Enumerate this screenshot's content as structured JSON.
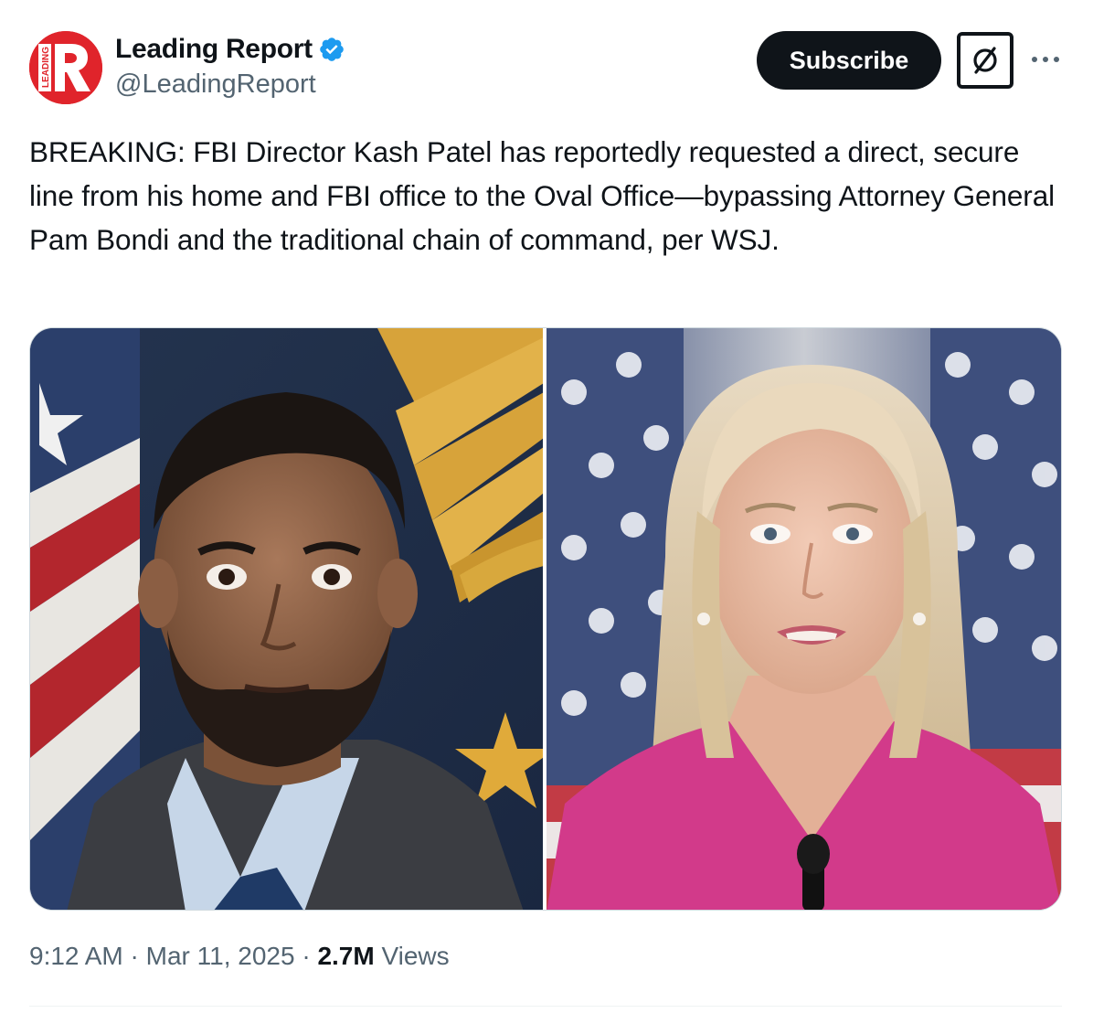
{
  "author": {
    "display_name": "Leading Report",
    "handle": "@LeadingReport",
    "verified": true,
    "avatar": {
      "letter": "R",
      "side_text": "LEADING",
      "color": "#e0242b"
    }
  },
  "actions": {
    "subscribe_label": "Subscribe",
    "grok_icon": "grok-icon",
    "more_icon": "more-horizontal-icon"
  },
  "tweet": {
    "text": "BREAKING: FBI Director Kash Patel has reportedly requested a direct, secure line from his home and FBI office to the Oval Office—bypassing Attorney General Pam Bondi and the traditional chain of command, per WSJ."
  },
  "media": {
    "images": [
      {
        "subject": "man-portrait"
      },
      {
        "subject": "woman-portrait"
      }
    ]
  },
  "meta": {
    "time": "9:12 AM",
    "separator": " · ",
    "date": "Mar 11, 2025",
    "views_count": "2.7M",
    "views_label": " Views"
  },
  "colors": {
    "text_primary": "#0f1419",
    "text_secondary": "#536471",
    "verified_blue": "#1d9bf0",
    "button_dark": "#0f1419"
  }
}
